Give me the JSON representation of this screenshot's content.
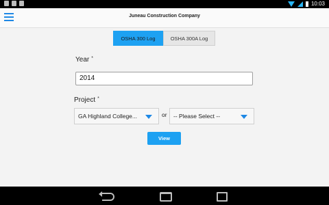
{
  "status_bar": {
    "time": "10:03"
  },
  "header": {
    "title": "Juneau Construction Company"
  },
  "tabs": [
    {
      "label": "OSHA 300  Log",
      "active": true
    },
    {
      "label": "OSHA 300A Log",
      "active": false
    }
  ],
  "form": {
    "year": {
      "label": "Year",
      "required_mark": "*",
      "value": "2014"
    },
    "project": {
      "label": "Project",
      "required_mark": "*",
      "selected": "GA Highland College...",
      "or_text": "or",
      "alternative_selected": "-- Please Select --"
    },
    "view_button": "View"
  },
  "colors": {
    "accent": "#1da1f2",
    "menu_icon": "#1e88e5"
  }
}
